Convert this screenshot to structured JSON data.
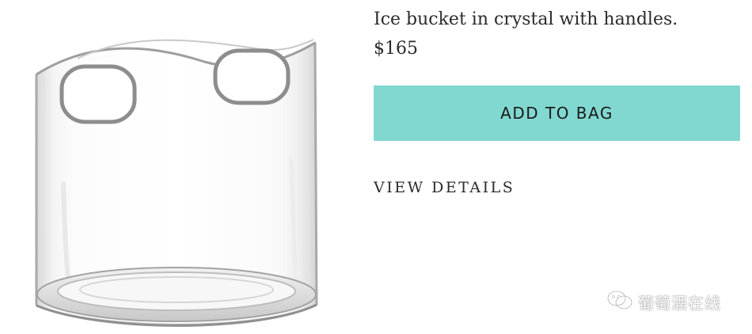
{
  "product": {
    "title": "Ice bucket in crystal with handles.",
    "price": "$165",
    "image_icon": "crystal-ice-bucket"
  },
  "actions": {
    "add_to_bag_label": "ADD TO BAG",
    "view_details_label": "VIEW DETAILS"
  },
  "watermark": {
    "text": "葡萄酒在线",
    "icon": "wechat-icon"
  },
  "colors": {
    "accent": "#81d8d0",
    "text": "#2b2b2b",
    "background": "#ffffff"
  }
}
